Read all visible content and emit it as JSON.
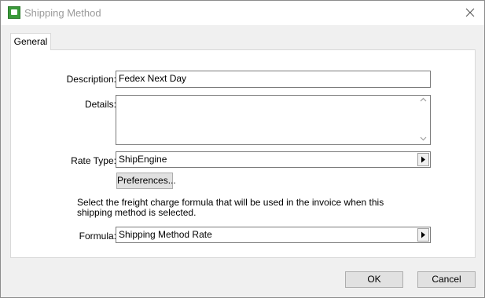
{
  "window": {
    "title": "Shipping Method"
  },
  "tabs": [
    {
      "label": "General"
    }
  ],
  "form": {
    "description": {
      "label": "Description:",
      "value": "Fedex Next Day"
    },
    "details": {
      "label": "Details:",
      "value": ""
    },
    "rate_type": {
      "label": "Rate Type:",
      "value": "ShipEngine"
    },
    "preferences_button": "Preferences...",
    "note": "Select the freight charge formula that will be used in the invoice when this shipping method is selected.",
    "formula": {
      "label": "Formula:",
      "value": "Shipping Method Rate"
    }
  },
  "buttons": {
    "ok": "OK",
    "cancel": "Cancel"
  },
  "icons": {
    "app": "app-icon",
    "close": "close-icon",
    "scroll_up": "scroll-up-icon",
    "scroll_down": "scroll-down-icon",
    "dropdown": "dropdown-arrow-icon"
  }
}
